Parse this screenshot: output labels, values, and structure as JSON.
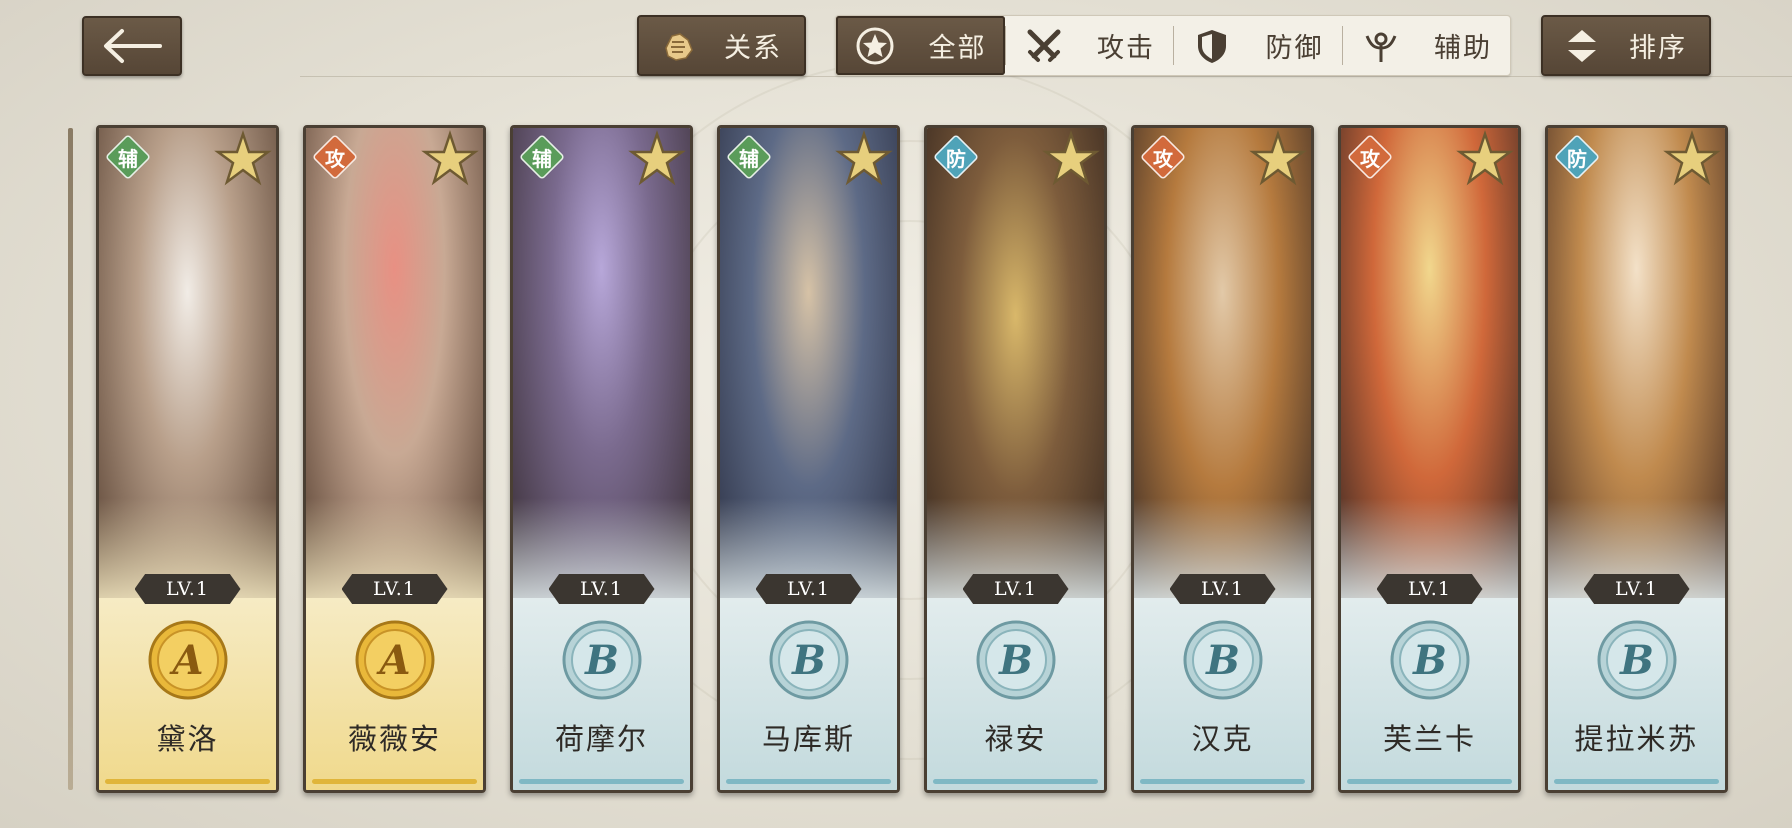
{
  "toolbar": {
    "relation_label": "关系",
    "sort_label": "排序"
  },
  "filters": [
    {
      "label": "全部",
      "icon": "star-circle-icon",
      "active": true
    },
    {
      "label": "攻击",
      "icon": "crossed-swords-icon",
      "active": false
    },
    {
      "label": "防御",
      "icon": "shield-icon",
      "active": false
    },
    {
      "label": "辅助",
      "icon": "support-staff-icon",
      "active": false
    }
  ],
  "heroes": [
    {
      "name": "黛洛",
      "role": "辅",
      "level": "LV.1",
      "rank": "A",
      "tier": "gold",
      "role_color": "#5a9c5a"
    },
    {
      "name": "薇薇安",
      "role": "攻",
      "level": "LV.1",
      "rank": "A",
      "tier": "gold",
      "role_color": "#d26a3c"
    },
    {
      "name": "荷摩尔",
      "role": "辅",
      "level": "LV.1",
      "rank": "B",
      "tier": "blue",
      "role_color": "#5a9c5a"
    },
    {
      "name": "马库斯",
      "role": "辅",
      "level": "LV.1",
      "rank": "B",
      "tier": "blue",
      "role_color": "#5a9c5a"
    },
    {
      "name": "禄安",
      "role": "防",
      "level": "LV.1",
      "rank": "B",
      "tier": "blue",
      "role_color": "#4fa3b8"
    },
    {
      "name": "汉克",
      "role": "攻",
      "level": "LV.1",
      "rank": "B",
      "tier": "blue",
      "role_color": "#d26a3c"
    },
    {
      "name": "芙兰卡",
      "role": "攻",
      "level": "LV.1",
      "rank": "B",
      "tier": "blue",
      "role_color": "#d26a3c"
    },
    {
      "name": "提拉米苏",
      "role": "防",
      "level": "LV.1",
      "rank": "B",
      "tier": "blue",
      "role_color": "#4fa3b8"
    }
  ]
}
